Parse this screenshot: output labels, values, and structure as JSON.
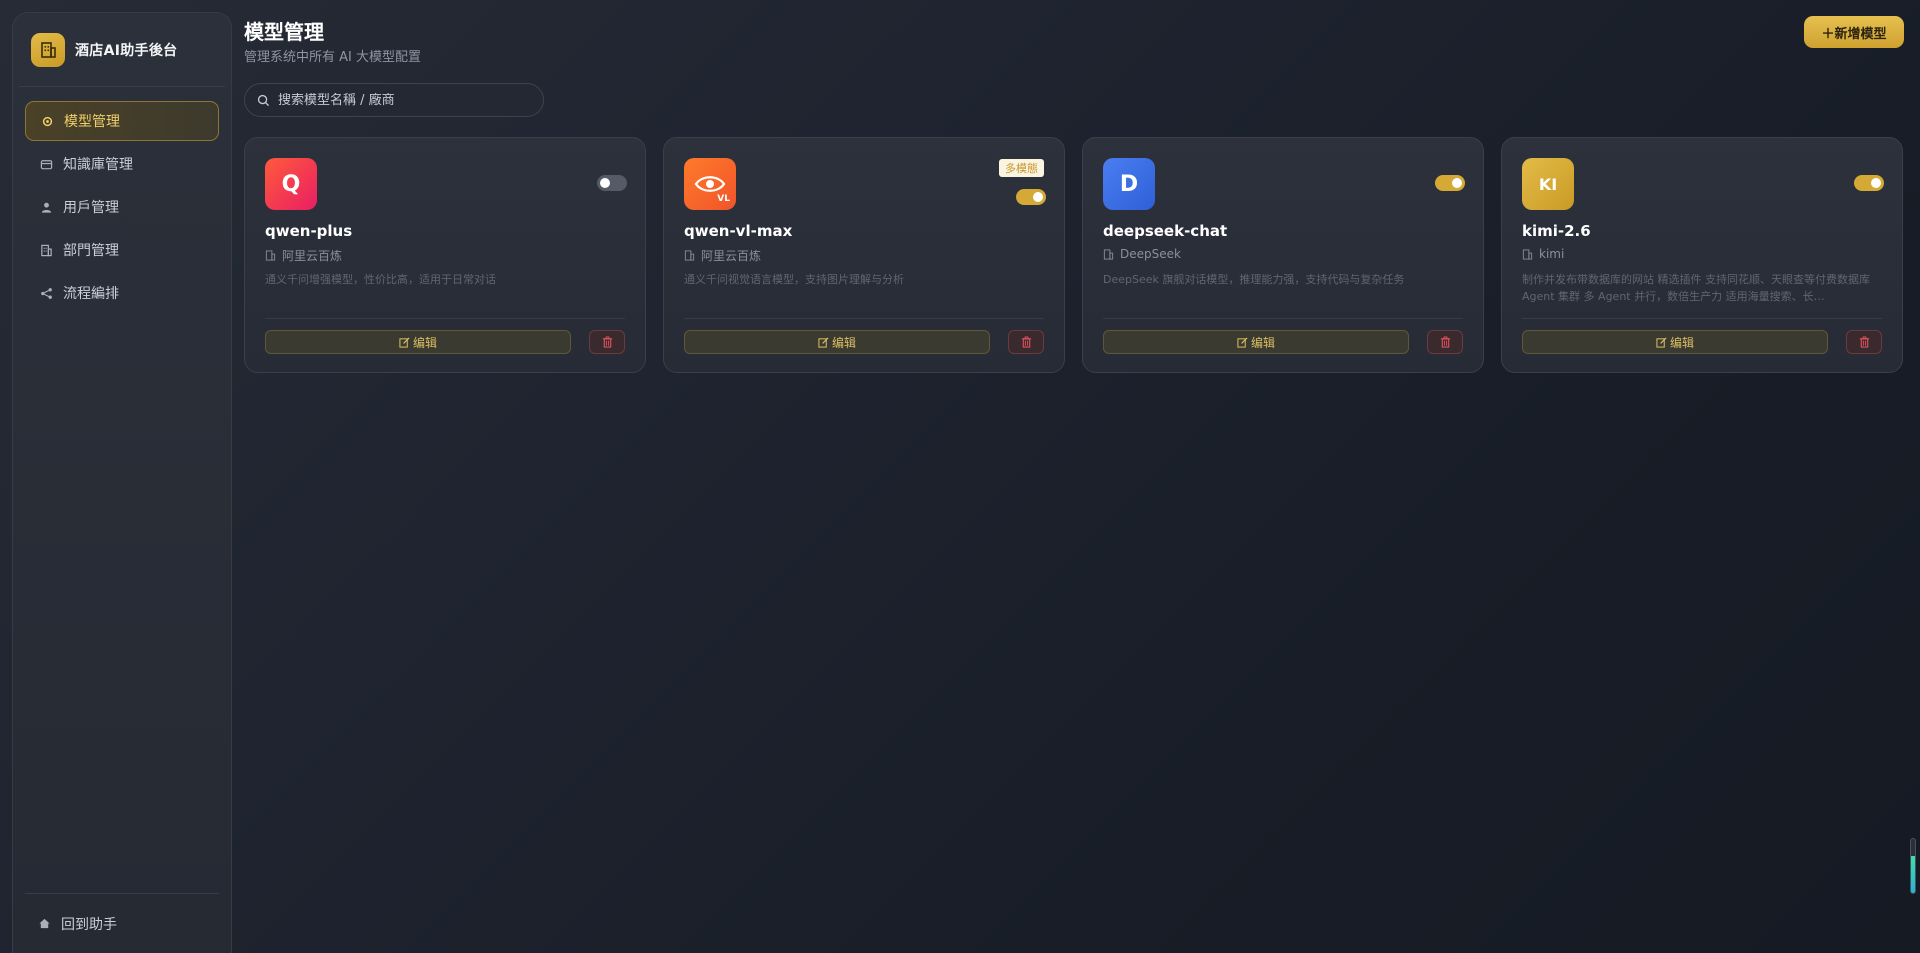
{
  "sidebar": {
    "brand_title": "酒店AI助手後台",
    "items": [
      {
        "label": "模型管理",
        "icon": "gear-icon",
        "active": true
      },
      {
        "label": "知識庫管理",
        "icon": "database-icon",
        "active": false
      },
      {
        "label": "用戶管理",
        "icon": "user-icon",
        "active": false
      },
      {
        "label": "部門管理",
        "icon": "building-icon",
        "active": false
      },
      {
        "label": "流程編排",
        "icon": "share-icon",
        "active": false
      }
    ],
    "bottom_label": "回到助手"
  },
  "header": {
    "title": "模型管理",
    "subtitle": "管理系统中所有 AI 大模型配置",
    "add_label": "＋新增模型"
  },
  "search": {
    "placeholder": "搜索模型名稱 / 廠商"
  },
  "cards": [
    {
      "icon_text": "Q",
      "name": "qwen-plus",
      "vendor": "阿里云百炼",
      "description": "通义千问增强模型，性价比高，适用于日常对话",
      "enabled": false,
      "badge": "",
      "edit_label": "编辑"
    },
    {
      "icon_text": "VL",
      "name": "qwen-vl-max",
      "vendor": "阿里云百炼",
      "description": "通义千问视觉语言模型，支持图片理解与分析",
      "enabled": true,
      "badge": "多模態",
      "edit_label": "编辑"
    },
    {
      "icon_text": "D",
      "name": "deepseek-chat",
      "vendor": "DeepSeek",
      "description": "DeepSeek 旗舰对话模型，推理能力强，支持代码与复杂任务",
      "enabled": true,
      "badge": "",
      "edit_label": "编辑"
    },
    {
      "icon_text": "KI",
      "name": "kimi-2.6",
      "vendor": "kimi",
      "description": "制作并发布带数据库的网站 精选插件 支持同花顺、天眼查等付费数据库 Agent 集群 多 Agent 并行，数倍生产力 适用海量搜索、长…",
      "enabled": true,
      "badge": "",
      "edit_label": "编辑"
    }
  ],
  "colors": {
    "accent": "#d4a935",
    "qwen_icon": "#f43f5e",
    "deepseek_icon": "#3b6fe0",
    "kimi_icon": "#d4a935",
    "danger": "#e0525c"
  },
  "scroll_progress": 0.68
}
